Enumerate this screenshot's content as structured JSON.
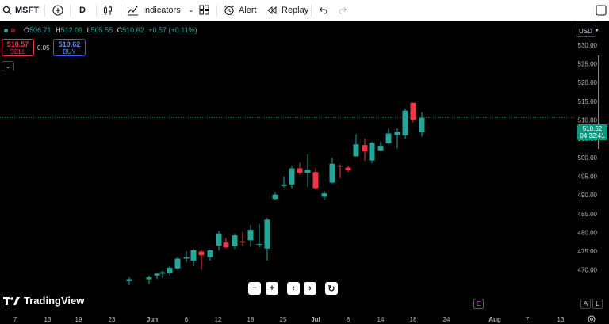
{
  "toolbar": {
    "symbol": "MSFT",
    "add_symbol": "+",
    "interval": "D",
    "indicators_label": "Indicators",
    "alert_label": "Alert",
    "replay_label": "Replay"
  },
  "legend": {
    "open_key": "O",
    "open": "506.71",
    "high_key": "H",
    "high": "512.09",
    "low_key": "L",
    "low": "505.55",
    "close_key": "C",
    "close": "510.62",
    "change": "+0.57 (+0.11%)"
  },
  "trade": {
    "sell_price": "510.57",
    "sell_label": "SELL",
    "spread": "0.05",
    "buy_price": "510.62",
    "buy_label": "BUY"
  },
  "currency": "USD",
  "last_price": {
    "price": "510.62",
    "countdown": "04:32:41"
  },
  "nav_buttons": [
    "−",
    "+",
    "‹",
    "›",
    "↻"
  ],
  "logo_text": "TradingView",
  "events_badge": "E",
  "scale_buttons": [
    "A",
    "L"
  ],
  "colors": {
    "up": "#26a69a",
    "down": "#f23645",
    "background": "#000000",
    "last_price": "#089981"
  },
  "chart_data": {
    "type": "candlestick",
    "symbol": "MSFT",
    "interval": "D",
    "y_ticks": [
      530,
      525,
      520,
      515,
      510,
      505,
      500,
      495,
      490,
      485,
      480,
      475,
      470
    ],
    "ylim": [
      467,
      532
    ],
    "x_ticks": [
      "7",
      "13",
      "19",
      "23",
      "Jun",
      "6",
      "12",
      "18",
      "25",
      "Jul",
      "8",
      "14",
      "18",
      "24",
      "Aug",
      "7",
      "13"
    ],
    "candles": [
      {
        "o": 467.0,
        "h": 468.0,
        "l": 466.0,
        "c": 467.5
      },
      {
        "o": 467.5,
        "h": 468.5,
        "l": 466.2,
        "c": 468.0
      },
      {
        "o": 468.5,
        "h": 469.2,
        "l": 467.5,
        "c": 469.0
      },
      {
        "o": 469.0,
        "h": 469.8,
        "l": 467.8,
        "c": 469.4
      },
      {
        "o": 469.2,
        "h": 471.0,
        "l": 468.5,
        "c": 470.6
      },
      {
        "o": 470.4,
        "h": 473.5,
        "l": 470.0,
        "c": 473.0
      },
      {
        "o": 473.0,
        "h": 475.0,
        "l": 472.0,
        "c": 473.3
      },
      {
        "o": 472.5,
        "h": 475.6,
        "l": 471.0,
        "c": 475.3
      },
      {
        "o": 474.9,
        "h": 475.3,
        "l": 470.0,
        "c": 473.9
      },
      {
        "o": 473.4,
        "h": 475.4,
        "l": 472.5,
        "c": 475.2
      },
      {
        "o": 476.5,
        "h": 480.4,
        "l": 475.2,
        "c": 479.7
      },
      {
        "o": 477.3,
        "h": 478.5,
        "l": 475.8,
        "c": 476.0
      },
      {
        "o": 476.3,
        "h": 479.6,
        "l": 475.7,
        "c": 479.2
      },
      {
        "o": 477.6,
        "h": 480.1,
        "l": 476.4,
        "c": 477.3
      },
      {
        "o": 477.9,
        "h": 481.9,
        "l": 476.2,
        "c": 480.7
      },
      {
        "o": 476.9,
        "h": 482.3,
        "l": 476.0,
        "c": 476.9
      },
      {
        "o": 475.7,
        "h": 483.9,
        "l": 472.5,
        "c": 483.4
      },
      {
        "o": 488.9,
        "h": 490.7,
        "l": 488.6,
        "c": 490.1
      },
      {
        "o": 492.4,
        "h": 494.9,
        "l": 492.0,
        "c": 492.8
      },
      {
        "o": 492.8,
        "h": 497.8,
        "l": 491.7,
        "c": 497.1
      },
      {
        "o": 497.1,
        "h": 498.6,
        "l": 495.4,
        "c": 495.9
      },
      {
        "o": 495.9,
        "h": 500.8,
        "l": 492.2,
        "c": 496.8
      },
      {
        "o": 496.1,
        "h": 497.1,
        "l": 491.4,
        "c": 491.8
      },
      {
        "o": 489.5,
        "h": 491.0,
        "l": 488.6,
        "c": 490.4
      },
      {
        "o": 493.3,
        "h": 499.9,
        "l": 493.0,
        "c": 498.3
      },
      {
        "o": 497.8,
        "h": 498.2,
        "l": 494.5,
        "c": 497.6
      },
      {
        "o": 497.3,
        "h": 497.8,
        "l": 496.1,
        "c": 496.6
      },
      {
        "o": 500.3,
        "h": 506.2,
        "l": 500.2,
        "c": 503.5
      },
      {
        "o": 503.3,
        "h": 505.0,
        "l": 499.1,
        "c": 501.6
      },
      {
        "o": 499.2,
        "h": 504.2,
        "l": 498.4,
        "c": 503.9
      },
      {
        "o": 501.9,
        "h": 504.2,
        "l": 501.7,
        "c": 503.1
      },
      {
        "o": 503.8,
        "h": 507.7,
        "l": 503.5,
        "c": 506.4
      },
      {
        "o": 506.0,
        "h": 507.8,
        "l": 502.4,
        "c": 506.9
      },
      {
        "o": 505.9,
        "h": 513.1,
        "l": 505.0,
        "c": 512.5
      },
      {
        "o": 514.6,
        "h": 514.6,
        "l": 509.3,
        "c": 510.0
      },
      {
        "o": 506.71,
        "h": 512.09,
        "l": 505.55,
        "c": 510.62
      }
    ]
  }
}
